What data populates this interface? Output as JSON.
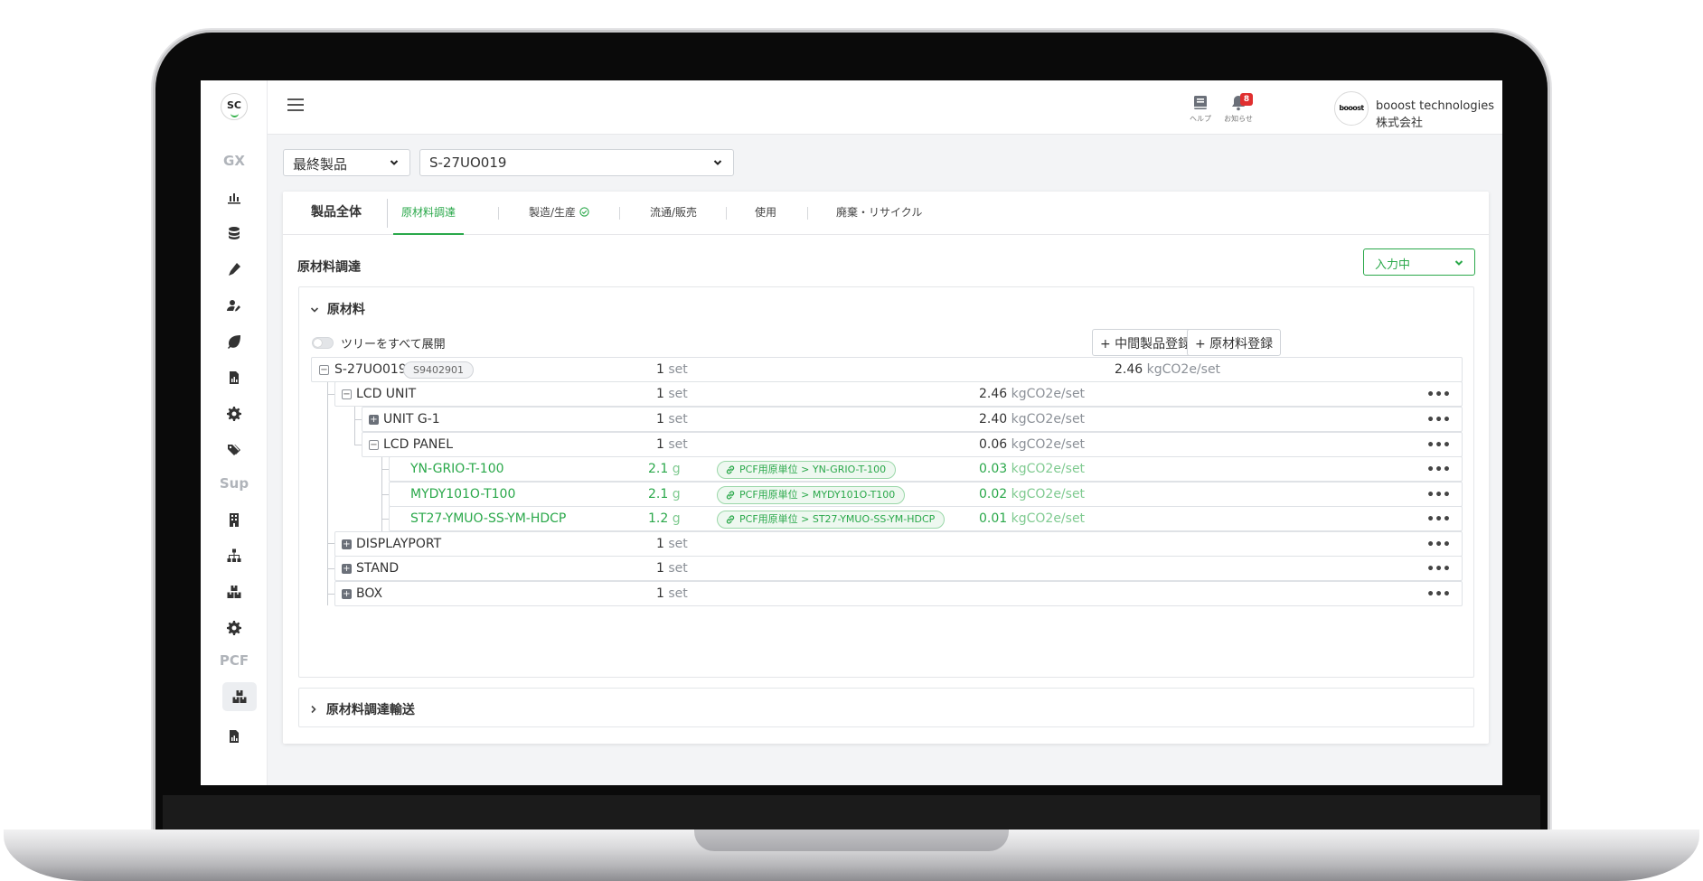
{
  "app": {
    "logo_text": "SC"
  },
  "sidebar": {
    "sections": [
      "GX",
      "Sup",
      "PCF"
    ]
  },
  "header": {
    "help_label": "ヘルプ",
    "notice_label": "お知らせ",
    "notice_count": "8",
    "avatar_text": "booost",
    "company": "booost technologies 株式会社"
  },
  "filters": {
    "product_type": "最終製品",
    "product_code": "S-27UO019"
  },
  "tabs": {
    "main": "製品全体",
    "items": [
      "原材料調達",
      "製造/生産",
      "流通/販売",
      "使用",
      "廃棄・リサイクル"
    ],
    "active_index": 0
  },
  "section": {
    "title": "原材料調達",
    "status": "入力中"
  },
  "panel": {
    "title": "原材料",
    "toggle_label": "ツリーをすべて展開",
    "btn_intermediate": "+ 中間製品登録",
    "btn_material": "+ 原材料登録"
  },
  "tree": {
    "root": {
      "name": "S-27UO019",
      "code": "S9402901",
      "qty": "1",
      "unit": "set",
      "emission": "2.46",
      "emission_unit": "kgCO2e/set"
    },
    "rows": [
      {
        "name": "LCD UNIT",
        "qty": "1",
        "unit": "set",
        "emission": "2.46",
        "emission_unit": "kgCO2e/set"
      },
      {
        "name": "UNIT G-1",
        "qty": "1",
        "unit": "set",
        "emission": "2.40",
        "emission_unit": "kgCO2e/set"
      },
      {
        "name": "LCD PANEL",
        "qty": "1",
        "unit": "set",
        "emission": "0.06",
        "emission_unit": "kgCO2e/set"
      },
      {
        "name": "YN-GRIO-T-100",
        "qty": "2.1",
        "unit": "g",
        "pcf": "PCF用原単位 > YN-GRIO-T-100",
        "emission": "0.03",
        "emission_unit": "kgCO2e/set"
      },
      {
        "name": "MYDY101O-T100",
        "qty": "2.1",
        "unit": "g",
        "pcf": "PCF用原単位 > MYDY101O-T100",
        "emission": "0.02",
        "emission_unit": "kgCO2e/set"
      },
      {
        "name": "ST27-YMUO-SS-YM-HDCP",
        "qty": "1.2",
        "unit": "g",
        "pcf": "PCF用原単位 > ST27-YMUO-SS-YM-HDCP",
        "emission": "0.01",
        "emission_unit": "kgCO2e/set"
      },
      {
        "name": "DISPLAYPORT",
        "qty": "1",
        "unit": "set"
      },
      {
        "name": "STAND",
        "qty": "1",
        "unit": "set"
      },
      {
        "name": "BOX",
        "qty": "1",
        "unit": "set"
      }
    ]
  },
  "transport": {
    "title": "原材料調達輸送"
  },
  "colors": {
    "accent": "#2aa84a",
    "badge": "#e02f2f"
  }
}
